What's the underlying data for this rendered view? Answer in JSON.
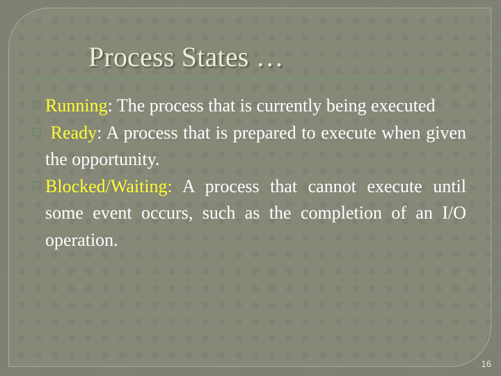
{
  "slide": {
    "title": "Process States …",
    "page_number": "16",
    "colors": {
      "background": "#7f8173",
      "panel": "#868878",
      "title": "#ecedd3",
      "text": "#ffffff",
      "term": "#ffff33",
      "bullet": "#6f8a6a",
      "rule": "#7d8e72"
    },
    "bullets": [
      {
        "icon": "square-bullet-icon",
        "term": "Running",
        "separator": ":",
        "text": " The process that is currently being executed"
      },
      {
        "icon": "square-bullet-icon",
        "term": " Ready",
        "separator": ":",
        "text": " A process that is prepared to execute when given the opportunity."
      },
      {
        "icon": "square-bullet-icon",
        "term": "Blocked/Waiting:",
        "separator": "",
        "text": "  A process that cannot execute until some event occurs, such as the completion of an I/O operation."
      }
    ]
  }
}
